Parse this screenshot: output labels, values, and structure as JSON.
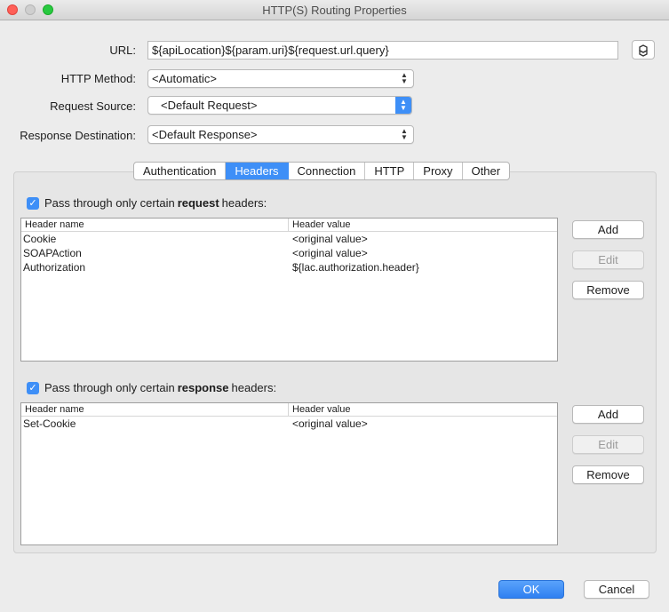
{
  "window": {
    "title": "HTTP(S) Routing Properties"
  },
  "form": {
    "url_label": "URL:",
    "url_value": "${apiLocation}${param.uri}${request.url.query}",
    "method_label": "HTTP Method:",
    "method_value": "<Automatic>",
    "source_label": "Request Source:",
    "source_value": "<Default Request>",
    "dest_label": "Response Destination:",
    "dest_value": "<Default Response>"
  },
  "tabs": [
    {
      "label": "Authentication"
    },
    {
      "label": "Headers"
    },
    {
      "label": "Connection"
    },
    {
      "label": "HTTP"
    },
    {
      "label": "Proxy"
    },
    {
      "label": "Other"
    }
  ],
  "selected_tab": "Headers",
  "request_headers": {
    "checked": true,
    "label_pre": "Pass through only certain ",
    "label_bold": "request",
    "label_post": " headers:",
    "columns": [
      "Header name",
      "Header value"
    ],
    "rows": [
      [
        "Cookie",
        "<original value>"
      ],
      [
        "SOAPAction",
        "<original value>"
      ],
      [
        "Authorization",
        "${lac.authorization.header}"
      ]
    ],
    "add_label": "Add",
    "edit_label": "Edit",
    "remove_label": "Remove"
  },
  "response_headers": {
    "checked": true,
    "label_pre": "Pass through only certain ",
    "label_bold": "response",
    "label_post": " headers:",
    "columns": [
      "Header name",
      "Header value"
    ],
    "rows": [
      [
        "Set-Cookie",
        "<original value>"
      ]
    ],
    "add_label": "Add",
    "edit_label": "Edit",
    "remove_label": "Remove"
  },
  "footer": {
    "ok_label": "OK",
    "cancel_label": "Cancel"
  },
  "colors": {
    "accent": "#3e8ff7",
    "close": "#ff5f57",
    "maximize": "#28c940"
  },
  "icons": {
    "url_button": "expression-builder-icon"
  }
}
